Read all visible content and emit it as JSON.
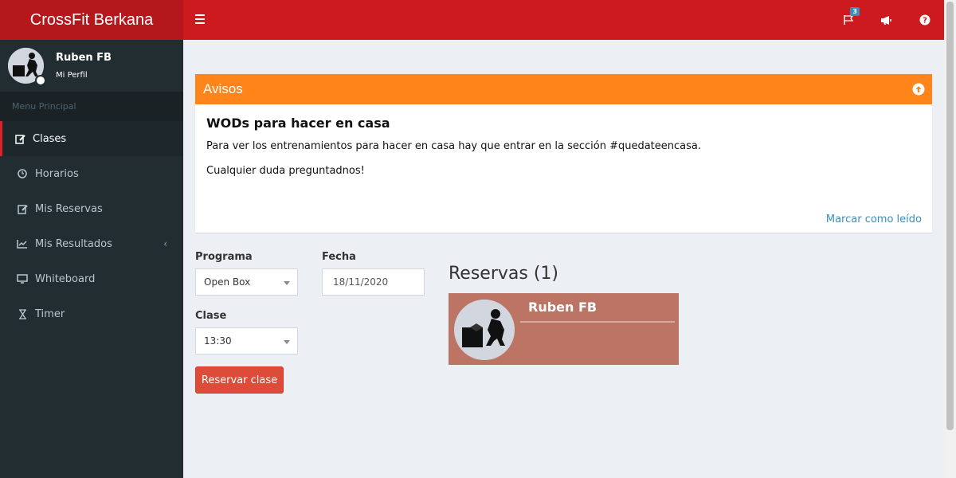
{
  "brand": "CrossFit Berkana",
  "user": {
    "name": "Ruben FB",
    "profile_link": "Mi Perfil"
  },
  "sidebar": {
    "header": "Menu Principal",
    "items": [
      {
        "label": "Clases",
        "icon": "edit-icon",
        "active": true
      },
      {
        "label": "Horarios",
        "icon": "clock-icon"
      },
      {
        "label": "Mis Reservas",
        "icon": "edit-icon"
      },
      {
        "label": "Mis Resultados",
        "icon": "line-chart-icon"
      },
      {
        "label": "Whiteboard",
        "icon": "monitor-icon"
      },
      {
        "label": "Timer",
        "icon": "hourglass-icon"
      }
    ]
  },
  "topbar": {
    "notification_count": "3"
  },
  "notice": {
    "title": "Avisos",
    "heading": "WODs para hacer en casa",
    "line1": "Para ver los entrenamientos para hacer en casa hay que entrar en la sección #quedateencasa.",
    "line2": "Cualquier duda preguntadnos!",
    "mark_read": "Marcar como leído"
  },
  "form": {
    "programa_label": "Programa",
    "programa_value": "Open Box",
    "fecha_label": "Fecha",
    "fecha_value": "18/11/2020",
    "clase_label": "Clase",
    "clase_value": "13:30",
    "submit_label": "Reservar clase"
  },
  "reservas": {
    "title": "Reservas (1)",
    "entries": [
      {
        "name": "Ruben FB"
      }
    ]
  },
  "colors": {
    "topbar": "#cc1a1e",
    "brand": "#b4181c",
    "notice_header": "#ff851b",
    "button": "#dd4b39",
    "reserva_card": "#bc7464"
  }
}
